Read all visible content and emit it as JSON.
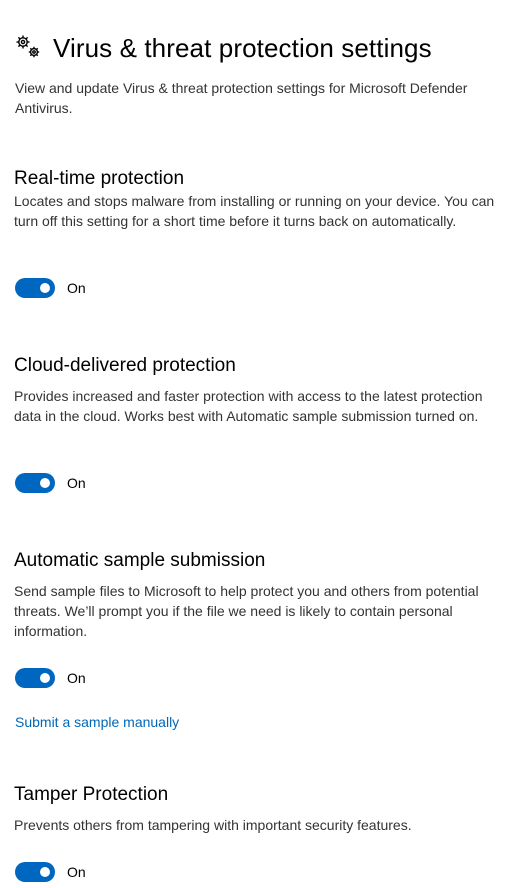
{
  "header": {
    "icon": "gears-icon",
    "title": "Virus & threat protection settings"
  },
  "intro": "View and update Virus & threat protection settings for Microsoft Defender Antivirus.",
  "accent_color": "#0067c0",
  "link_color": "#0067b8",
  "sections": [
    {
      "title": "Real-time protection",
      "description": "Locates and stops malware from installing or running on your device. You can turn off this setting for a short time before it turns back on automatically.",
      "toggle_state": "On"
    },
    {
      "title": "Cloud-delivered protection",
      "description": "Provides increased and faster protection with access to the latest protection data in the cloud. Works best with Automatic sample submission turned on.",
      "toggle_state": "On"
    },
    {
      "title": "Automatic sample submission",
      "description": "Send sample files to Microsoft to help protect you and others from potential threats. We’ll prompt you if the file we need is likely to contain personal information.",
      "toggle_state": "On",
      "link": "Submit a sample manually"
    },
    {
      "title": "Tamper Protection",
      "description": "Prevents others from tampering with important security features.",
      "toggle_state": "On"
    }
  ]
}
